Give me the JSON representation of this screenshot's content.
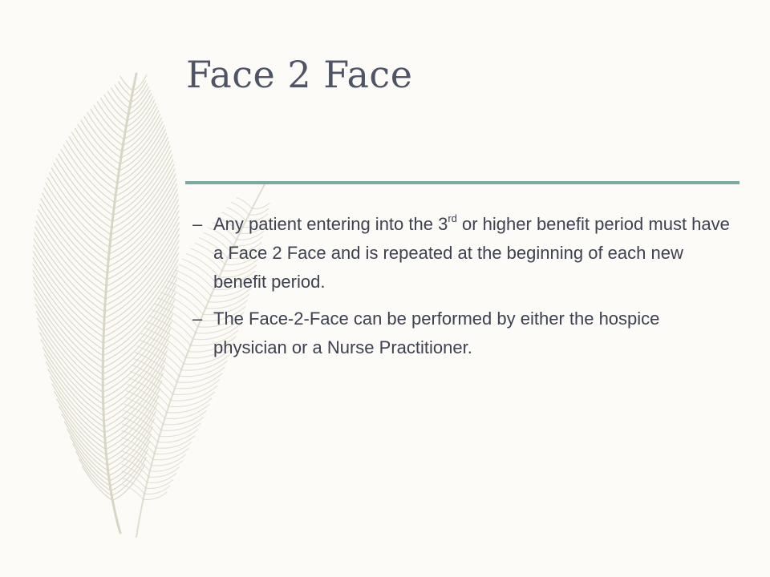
{
  "slide": {
    "title": "Face 2 Face",
    "accent_color": "#7ba8a0",
    "background_color": "#fcfbf7",
    "decoration": "feather-icon",
    "bullet_marker": "–",
    "bullets": [
      {
        "pre": "Any patient entering into the 3",
        "sup": "rd",
        "post": " or higher benefit period must have a Face 2 Face and is repeated at the beginning of each new benefit period."
      },
      {
        "text": "The Face-2-Face can be performed by either the hospice physician or a Nurse Practitioner."
      }
    ]
  }
}
